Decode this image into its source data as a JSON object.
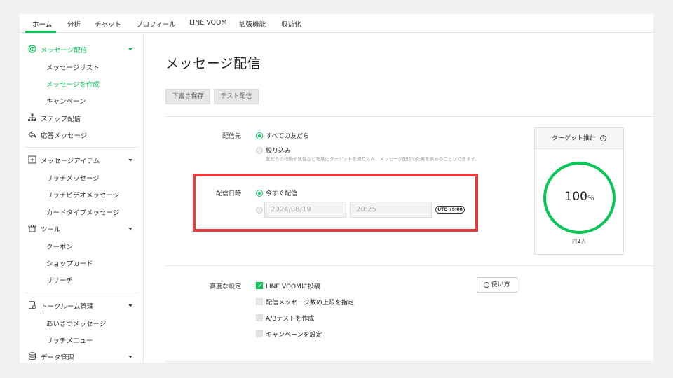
{
  "tabs": [
    {
      "label": "ホーム",
      "active": true
    },
    {
      "label": "分析"
    },
    {
      "label": "チャット"
    },
    {
      "label": "プロフィール"
    },
    {
      "label": "LINE VOOM"
    },
    {
      "label": "拡張機能"
    },
    {
      "label": "収益化"
    }
  ],
  "sidebar": {
    "message": {
      "label": "メッセージ配信",
      "icon": "target-icon"
    },
    "message_list": "メッセージリスト",
    "message_create": "メッセージを作成",
    "campaign": "キャンペーン",
    "step": {
      "label": "ステップ配信",
      "icon": "hierarchy-icon"
    },
    "reply": {
      "label": "応答メッセージ",
      "icon": "reply-icon"
    },
    "items": {
      "label": "メッセージアイテム",
      "icon": "plus-square-icon"
    },
    "rich_message": "リッチメッセージ",
    "rich_video": "リッチビデオメッセージ",
    "card_type": "カードタイプメッセージ",
    "tools": {
      "label": "ツール",
      "icon": "shop-icon"
    },
    "coupon": "クーポン",
    "shop_card": "ショップカード",
    "research": "リサーチ",
    "talkroom": {
      "label": "トークルーム管理",
      "icon": "talkroom-icon"
    },
    "greeting": "あいさつメッセージ",
    "rich_menu": "リッチメニュー",
    "data": {
      "label": "データ管理",
      "icon": "database-icon"
    }
  },
  "main": {
    "title": "メッセージ配信",
    "draft_button": "下書き保存",
    "test_button": "テスト配信",
    "audience": {
      "label": "配信先",
      "option_all": "すべての友だち",
      "option_filter": "絞り込み",
      "filter_hint": "友だちの行動や属性などを基にターゲットを絞り込み、メッセージ配信の効果を高めることができます。"
    },
    "schedule": {
      "label": "配信日時",
      "option_now": "今すぐ配信",
      "date_placeholder": "2024/08/19",
      "time_placeholder": "20:25",
      "timezone": "UTC +9:00"
    },
    "target": {
      "header": "ターゲット推計",
      "percent": "100",
      "percent_unit": "%",
      "approx_prefix": "約",
      "approx_count": "2",
      "approx_unit": "人"
    },
    "advanced": {
      "label": "高度な設定",
      "voom": "LINE VOOMに投稿",
      "limit": "配信メッセージ数の上限を指定",
      "ab_test": "A/Bテストを作成",
      "campaign": "キャンペーンを設定",
      "howto": "使い方"
    }
  },
  "colors": {
    "accent": "#06c755",
    "highlight": "#e53e3e"
  }
}
